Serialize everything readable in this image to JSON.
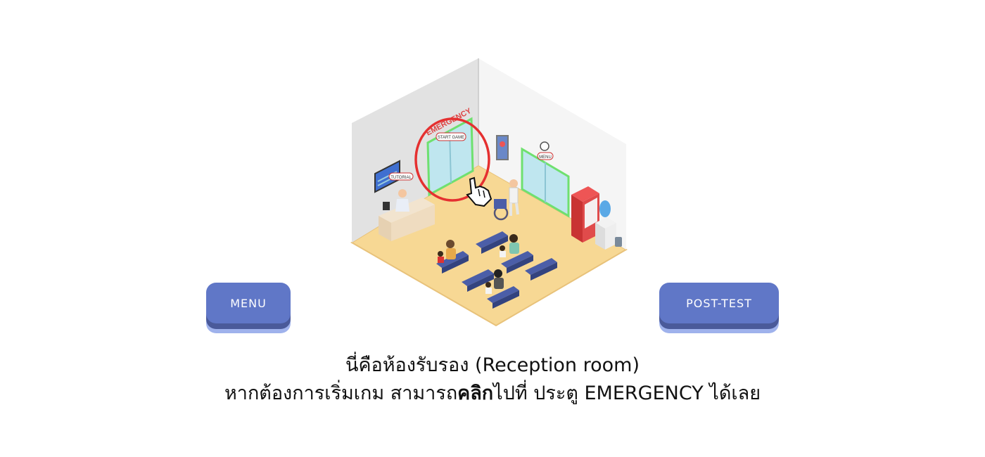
{
  "scene": {
    "door_emergency": {
      "sign": "EMERGENCY",
      "tag": "START GAME"
    },
    "door_menu": {
      "tag": "MENU"
    },
    "tv_tag": "TUTORIAL"
  },
  "buttons": {
    "menu_label": "MENU",
    "post_test_label": "POST-TEST"
  },
  "caption": {
    "line1": "นี่คือห้องรับรอง (Reception room)",
    "line2_pre": "หากต้องการเริ่มเกม สามารถ",
    "line2_bold": "คลิก",
    "line2_post": "ไปที่ ประตู EMERGENCY ได้เลย"
  },
  "colors": {
    "button_face": "#6077c7",
    "button_shadow": "#4a5a9a",
    "floor": "#f7d894",
    "highlight_circle": "#e53030",
    "door_glow": "#6fe06f"
  }
}
